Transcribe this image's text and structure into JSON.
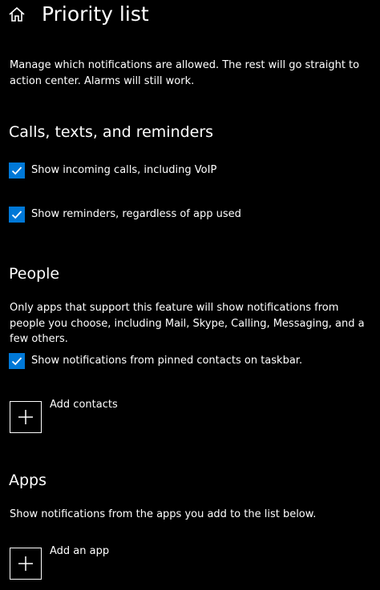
{
  "header": {
    "title": "Priority list",
    "home_icon": "home-icon"
  },
  "intro": {
    "description": "Manage which notifications are allowed. The rest will go straight to action center. Alarms will still work."
  },
  "calls_section": {
    "heading": "Calls, texts, and reminders",
    "items": [
      {
        "label": "Show incoming calls, including VoIP",
        "checked": true
      },
      {
        "label": "Show reminders, regardless of app used",
        "checked": true
      }
    ]
  },
  "people_section": {
    "heading": "People",
    "description": "Only apps that support this feature will show notifications from people you choose, including Mail, Skype, Calling, Messaging, and a few others.",
    "items": [
      {
        "label": "Show notifications from pinned contacts on taskbar.",
        "checked": true
      }
    ],
    "add_label": "Add contacts",
    "add_icon": "plus-icon"
  },
  "apps_section": {
    "heading": "Apps",
    "description": "Show notifications from the apps you add to the list below.",
    "add_label": "Add an app",
    "add_icon": "plus-icon"
  },
  "colors": {
    "background": "#000000",
    "text": "#ffffff",
    "accent": "#0078d7"
  }
}
